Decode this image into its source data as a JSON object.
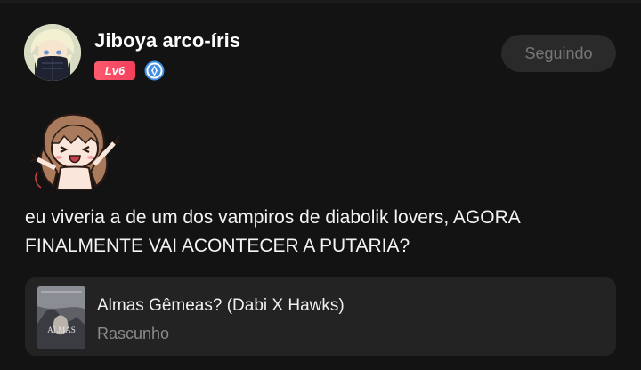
{
  "author": {
    "name": "Jiboya arco-íris",
    "level": "Lv6",
    "avatar_icon": "anime-avatar-icon",
    "role_icon": "curator-badge-icon"
  },
  "follow_button": {
    "label": "Seguindo"
  },
  "post": {
    "sticker_icon": "chibi-sticker-icon",
    "text": "eu viveria a de um dos vampiros de diabolik lovers, AGORA FINALMENTE VAI ACONTECER A PUTARIA?"
  },
  "linked_story": {
    "title": "Almas Gêmeas? (Dabi X Hawks)",
    "status": "Rascunho",
    "cover_text": "ALMAS"
  },
  "colors": {
    "background": "#131313",
    "card": "#232323",
    "level_badge": "#f23f5d",
    "role_badge": "#3f8fe6",
    "follow_button_bg": "#2a2a2a",
    "muted_text": "#8a8a8a"
  }
}
